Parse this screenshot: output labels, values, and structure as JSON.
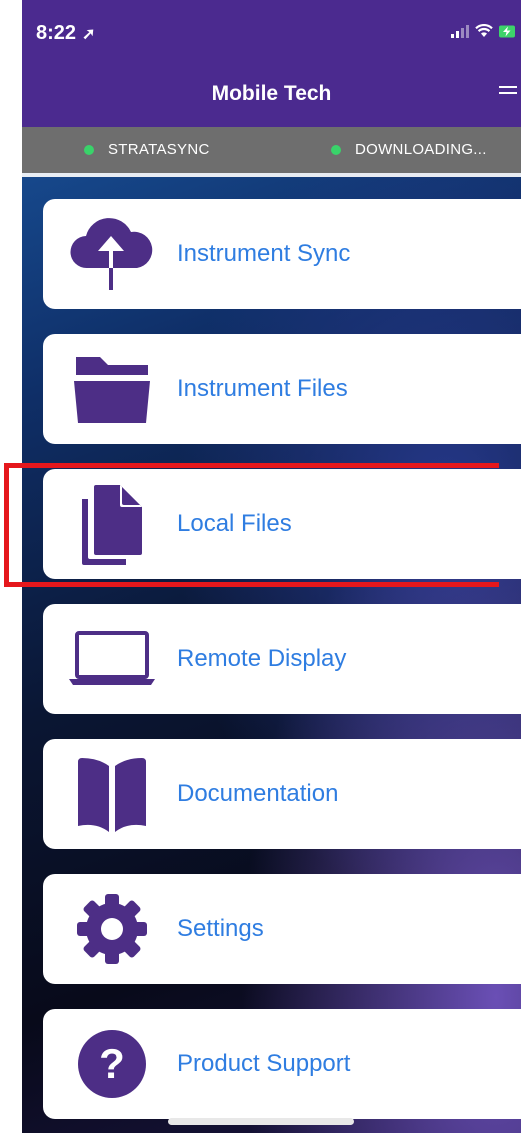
{
  "status_bar": {
    "time": "8:22",
    "location_arrow": "location-arrow-icon"
  },
  "header": {
    "title": "Mobile Tech",
    "menu_icon": "hamburger-menu-icon"
  },
  "sync_bar": {
    "items": [
      {
        "label": "STRATASYNC",
        "status_color": "#39d36a"
      },
      {
        "label": "DOWNLOADING...",
        "status_color": "#39d36a"
      }
    ]
  },
  "menu": {
    "items": [
      {
        "label": "Instrument Sync",
        "icon": "cloud-upload-icon"
      },
      {
        "label": "Instrument Files",
        "icon": "folder-icon"
      },
      {
        "label": "Local Files",
        "icon": "documents-icon",
        "highlighted": true
      },
      {
        "label": "Remote Display",
        "icon": "laptop-icon"
      },
      {
        "label": "Documentation",
        "icon": "book-icon"
      },
      {
        "label": "Settings",
        "icon": "gear-icon"
      },
      {
        "label": "Product Support",
        "icon": "question-circle-icon"
      }
    ]
  },
  "colors": {
    "brand_purple": "#4b2a8f",
    "icon_purple": "#4d2e86",
    "link_blue": "#2f7de1",
    "highlight_red": "#e5171c",
    "sync_bar_gray": "#6e6e6e",
    "status_green": "#39d36a"
  }
}
